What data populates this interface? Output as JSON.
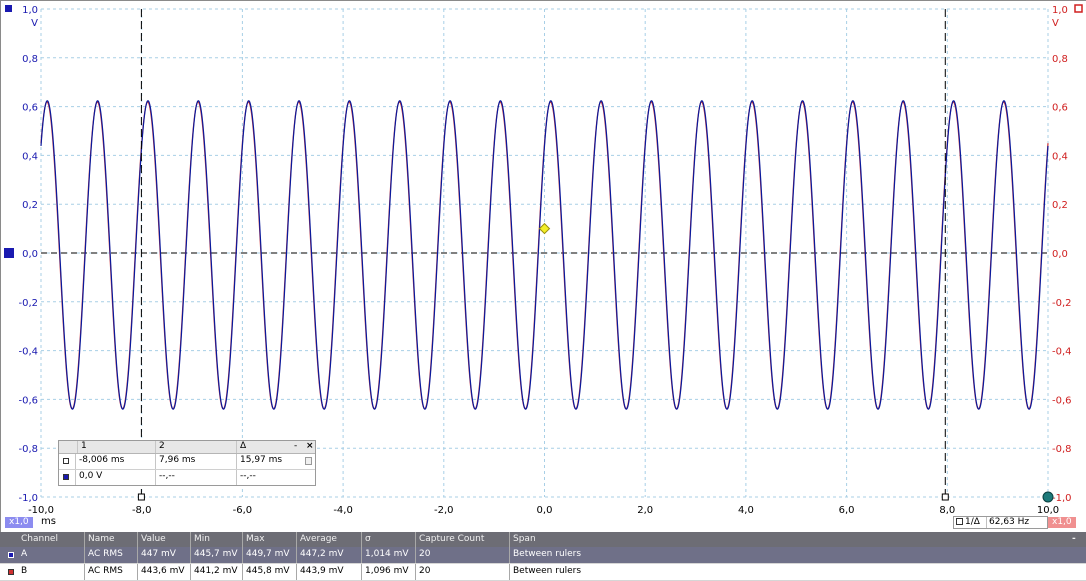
{
  "axes": {
    "left_unit": "V",
    "right_unit": "V",
    "x_unit": "ms",
    "y_ticks": [
      "1,0",
      "0,8",
      "0,6",
      "0,4",
      "0,2",
      "0,0",
      "-0,2",
      "-0,4",
      "-0,6",
      "-0,8",
      "-1,0"
    ],
    "x_ticks": [
      "-10,0",
      "-8,0",
      "-6,0",
      "-4,0",
      "-2,0",
      "0,0",
      "2,0",
      "4,0",
      "6,0",
      "8,0",
      "10,0"
    ],
    "zoom_a": "x1,0",
    "zoom_b": "x1,0"
  },
  "colors": {
    "channel_a": "#0a1a9c",
    "channel_b": "#d03030",
    "left_axis_text": "#1a1ab0",
    "right_axis_text": "#d02020",
    "grid": "#a8cfe6",
    "trigger": "#f2ee28",
    "rulers": "#000000"
  },
  "chart_data": {
    "type": "line",
    "x_range": [
      -10.0,
      10.0
    ],
    "y_range": [
      -1.0,
      1.0
    ],
    "frequency_hz": 1000,
    "series": [
      {
        "name": "A",
        "amplitude_v": 0.632,
        "offset_v": -0.008,
        "phase_deg": 45
      },
      {
        "name": "B",
        "amplitude_v": 0.629,
        "offset_v": -0.01,
        "phase_deg": 47
      }
    ],
    "rulers_ms": [
      -8.006,
      7.96
    ],
    "trigger": {
      "time_ms": 0.0,
      "level_v": 0.1
    }
  },
  "ruler_popup": {
    "headers": [
      "1",
      "2",
      "Δ"
    ],
    "row_time": [
      "-8,006 ms",
      "7,96 ms",
      "15,97 ms"
    ],
    "row_volt": [
      "0,0 V",
      "--,--",
      "--,--"
    ],
    "minimize": "-",
    "close": "×"
  },
  "freq_box": {
    "label": "1/Δ",
    "value": "62,63 Hz"
  },
  "measurements": {
    "headers": [
      "Channel",
      "Name",
      "Value",
      "Min",
      "Max",
      "Average",
      "σ",
      "Capture Count",
      "Span"
    ],
    "collapse": "-",
    "rows": [
      [
        "A",
        "AC RMS",
        "447 mV",
        "445,7 mV",
        "449,7 mV",
        "447,2 mV",
        "1,014 mV",
        "20",
        "Between rulers"
      ],
      [
        "B",
        "AC RMS",
        "443,6 mV",
        "441,2 mV",
        "445,8 mV",
        "443,9 mV",
        "1,096 mV",
        "20",
        "Between rulers"
      ]
    ]
  }
}
